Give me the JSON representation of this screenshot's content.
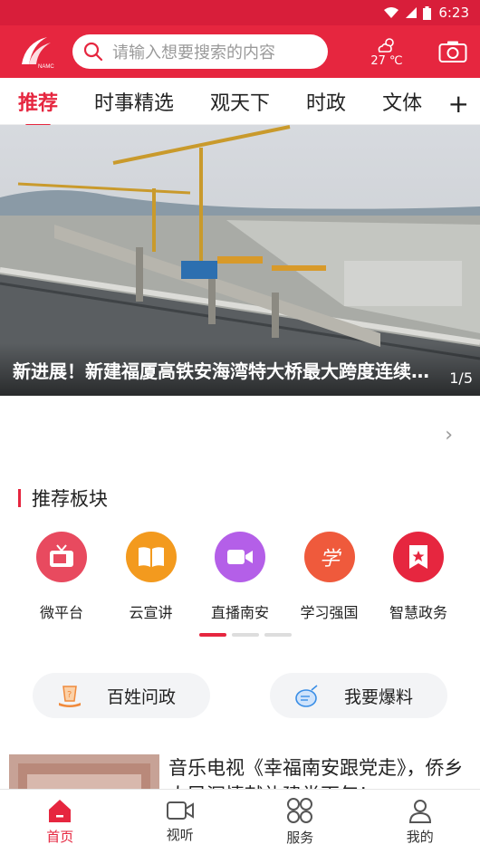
{
  "status": {
    "time": "6:23",
    "icons": [
      "wifi-icon",
      "signal-icon",
      "battery-icon"
    ]
  },
  "header": {
    "logo_text": "NAMC",
    "search_placeholder": "请输入想要搜索的内容",
    "weather_temp": "27 ℃",
    "weather_icon": "cloud-sun-icon",
    "camera_icon": "camera-icon"
  },
  "tabs": [
    {
      "label": "推荐",
      "active": true
    },
    {
      "label": "时事精选",
      "active": false
    },
    {
      "label": "观天下",
      "active": false
    },
    {
      "label": "时政",
      "active": false
    },
    {
      "label": "文体",
      "active": false
    }
  ],
  "tab_add": "+",
  "banner": {
    "title": "新进展！新建福厦高铁安海湾特大桥最大跨度连续梁合龙",
    "pager": "1/5"
  },
  "notice": {
    "arrow": "›"
  },
  "section": {
    "title": "推荐板块"
  },
  "grid": [
    {
      "label": "微平台",
      "icon": "tv-icon",
      "color": "#e84a5f"
    },
    {
      "label": "云宣讲",
      "icon": "book-icon",
      "color": "#f39a1e"
    },
    {
      "label": "直播南安",
      "icon": "video-icon",
      "color": "#b45fe8"
    },
    {
      "label": "学习强国",
      "icon": "xue-icon",
      "color": "#ef5a3c"
    },
    {
      "label": "智慧政务",
      "icon": "gov-badge-icon",
      "color": "#e6263f"
    }
  ],
  "pager_dots": 3,
  "actions": [
    {
      "label": "百姓问政",
      "icon": "question-hand-icon"
    },
    {
      "label": "我要爆料",
      "icon": "bomb-icon"
    }
  ],
  "news": [
    {
      "title": "音乐电视《幸福南安跟党走》，侨乡人民深情献礼建党百年！"
    }
  ],
  "bottom_nav": [
    {
      "label": "首页",
      "icon": "home-icon",
      "active": true
    },
    {
      "label": "视听",
      "icon": "video-camera-icon",
      "active": false
    },
    {
      "label": "服务",
      "icon": "grid-circles-icon",
      "active": false
    },
    {
      "label": "我的",
      "icon": "user-icon",
      "active": false
    }
  ],
  "colors": {
    "brand": "#e6263f",
    "status_bar": "#d81e3a"
  }
}
